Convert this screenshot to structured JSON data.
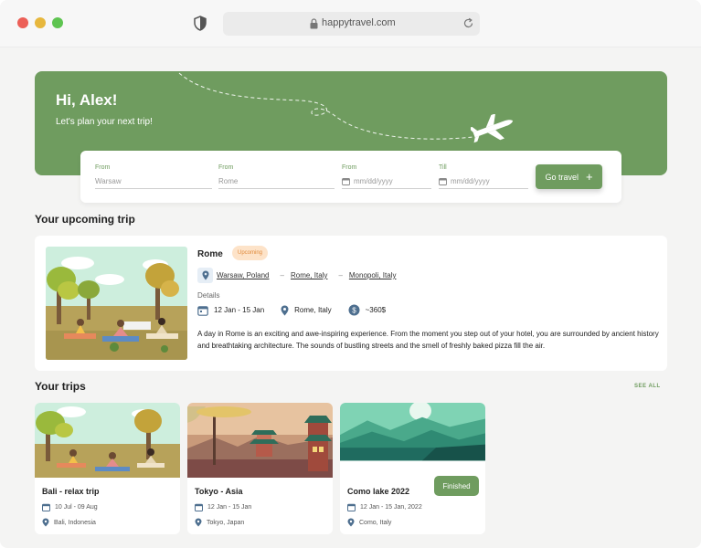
{
  "browser": {
    "url": "happytravel.com"
  },
  "hero": {
    "greeting": "Hi, Alex!",
    "subtitle": "Let's plan your next trip!"
  },
  "search": {
    "fields": [
      {
        "label": "From",
        "placeholder": "Warsaw"
      },
      {
        "label": "From",
        "placeholder": "Rome"
      },
      {
        "label": "From",
        "placeholder": "mm/dd/yyyy"
      },
      {
        "label": "Till",
        "placeholder": "mm/dd/yyyy"
      }
    ],
    "button_label": "Go travel"
  },
  "upcoming": {
    "section_title": "Your upcoming trip",
    "name": "Rome",
    "status": "Upcoming",
    "route": [
      "Warsaw, Poland",
      "Rome, Italy",
      "Monopoli, Italy"
    ],
    "route_separator": "–",
    "details_label": "Details",
    "dates": "12 Jan - 15 Jan",
    "location": "Rome, Italy",
    "budget": "~360$",
    "description": "A day in Rome is an exciting and awe-inspiring experience. From the moment you step out of your hotel, you are surrounded by ancient history and breathtaking architecture. The sounds of bustling streets and the smell of freshly baked pizza fill the air."
  },
  "trips": {
    "section_title": "Your trips",
    "see_all_label": "SEE ALL",
    "items": [
      {
        "name": "Bali - relax trip",
        "dates": "10 Jul - 09 Aug",
        "location": "Bali, Indonesia",
        "badge": ""
      },
      {
        "name": "Tokyo - Asia",
        "dates": "12 Jan - 15 Jan",
        "location": "Tokyo, Japan",
        "badge": ""
      },
      {
        "name": "Como lake 2022",
        "dates": "12 Jan - 15 Jan, 2022",
        "location": "Como, Italy",
        "badge": "Finished"
      }
    ]
  },
  "colors": {
    "accent": "#6f9c5f",
    "upcoming_badge_bg": "#fde3c9",
    "upcoming_badge_text": "#e08a3c",
    "icon_blue": "#4e6f8f"
  },
  "icons": {
    "privacy": "shield-icon",
    "lock": "lock-icon",
    "reload": "reload-icon",
    "plane": "airplane-icon",
    "calendar": "calendar-icon",
    "pin": "location-pin-icon",
    "money": "dollar-coin-icon",
    "plus": "plus-icon"
  }
}
